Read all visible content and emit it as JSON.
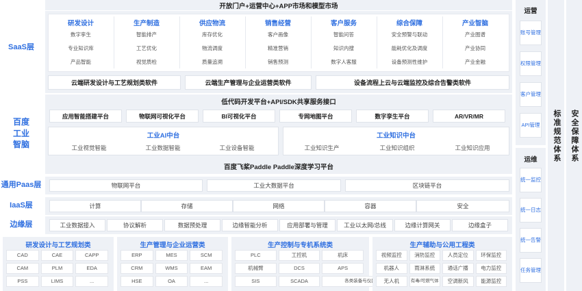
{
  "top_title": "开放门户+运营中心+APP市场和模型市场",
  "layers": {
    "saas": "SaaS层",
    "baidu": "百度\n工业\n智脑",
    "paas": "通用Paas层",
    "iaas": "IaaS层",
    "edge": "边缘层"
  },
  "saas_columns": [
    {
      "title": "研发设计",
      "items": [
        "数字孪生",
        "专业知识库",
        "产品智能"
      ]
    },
    {
      "title": "生产制造",
      "items": [
        "智能排产",
        "工艺优化",
        "视觉质检"
      ]
    },
    {
      "title": "供应物流",
      "items": [
        "库存优化",
        "物流调度",
        "质量追溯"
      ]
    },
    {
      "title": "销售经营",
      "items": [
        "客户画像",
        "精准营销",
        "销售预测"
      ]
    },
    {
      "title": "客户服务",
      "items": [
        "智能问答",
        "知识内搜",
        "数字人客服"
      ]
    },
    {
      "title": "综合保障",
      "items": [
        "安全预警与联动",
        "能耗优化及调度",
        "设备预测性维护"
      ]
    },
    {
      "title": "产业智脑",
      "items": [
        "产业图谱",
        "产业协同",
        "产业金融"
      ]
    }
  ],
  "saas_bars": [
    "云端研发设计与工艺规划类软件",
    "云端生产管理与企业运营类软件",
    "设备流程上云与云端监控及综合告警类软件"
  ],
  "lowcode": "低代码开发平台+API/SDK共享服务接口",
  "platforms": [
    "应用智能搭建平台",
    "物联网可视化平台",
    "BI可视化平台",
    "专网地图平台",
    "数字孪生平台",
    "AR/VR/MR"
  ],
  "ai_center": {
    "title": "工业AI中台",
    "items": [
      "工业视觉智能",
      "工业数据智能",
      "工业设备智能"
    ]
  },
  "kg_center": {
    "title": "工业知识中台",
    "items": [
      "工业知识生产",
      "工业知识组织",
      "工业知识应用"
    ]
  },
  "paddle": "百度飞桨Paddle Paddle深度学习平台",
  "paas_items": [
    "物联网平台",
    "工业大数据平台",
    "区块链平台"
  ],
  "iaas_items": [
    "计算",
    "存储",
    "网络",
    "容器",
    "安全"
  ],
  "edge_items": [
    "工业数据接入",
    "协议解析",
    "数据预处理",
    "边缘智能分析",
    "应用部署与管理",
    "工业以太网/总线",
    "边缘计算网关",
    "边缘盒子"
  ],
  "bottom_groups": [
    {
      "title": "研发设计与工艺规划类",
      "cells": [
        "CAD",
        "CAE",
        "CAPP",
        "CAM",
        "PLM",
        "EDA",
        "PSS",
        "LIMS",
        "..."
      ]
    },
    {
      "title": "生产管理与企业运营类",
      "cells": [
        "ERP",
        "MES",
        "SCM",
        "CRM",
        "WMS",
        "EAM",
        "HSE",
        "OA",
        "..."
      ]
    },
    {
      "title": "生产控制与专机系统类",
      "cells": [
        "PLC",
        "工控机",
        "机床",
        "机械臂",
        "DCS",
        "APS",
        "SIS",
        "SCADA",
        "各类装备与仪器仪表"
      ]
    },
    {
      "title": "生产辅助与公用工程类",
      "cells": [
        "视频监控",
        "消防监控",
        "人员定位",
        "环保监控",
        "机器人",
        "雨淋系统",
        "通话广播",
        "电力监控",
        "无人机",
        "有毒/可燃气体",
        "空调新风",
        "能源监控"
      ]
    }
  ],
  "ops": {
    "title": "运营",
    "items": [
      "账号管理",
      "权限管理",
      "客户管理",
      "API管理"
    ]
  },
  "maint": {
    "title": "运维",
    "items": [
      "统一监控",
      "统一日志",
      "统一告警",
      "任务管理"
    ]
  },
  "standards": "标准规范体系",
  "security": "安全保障体系"
}
